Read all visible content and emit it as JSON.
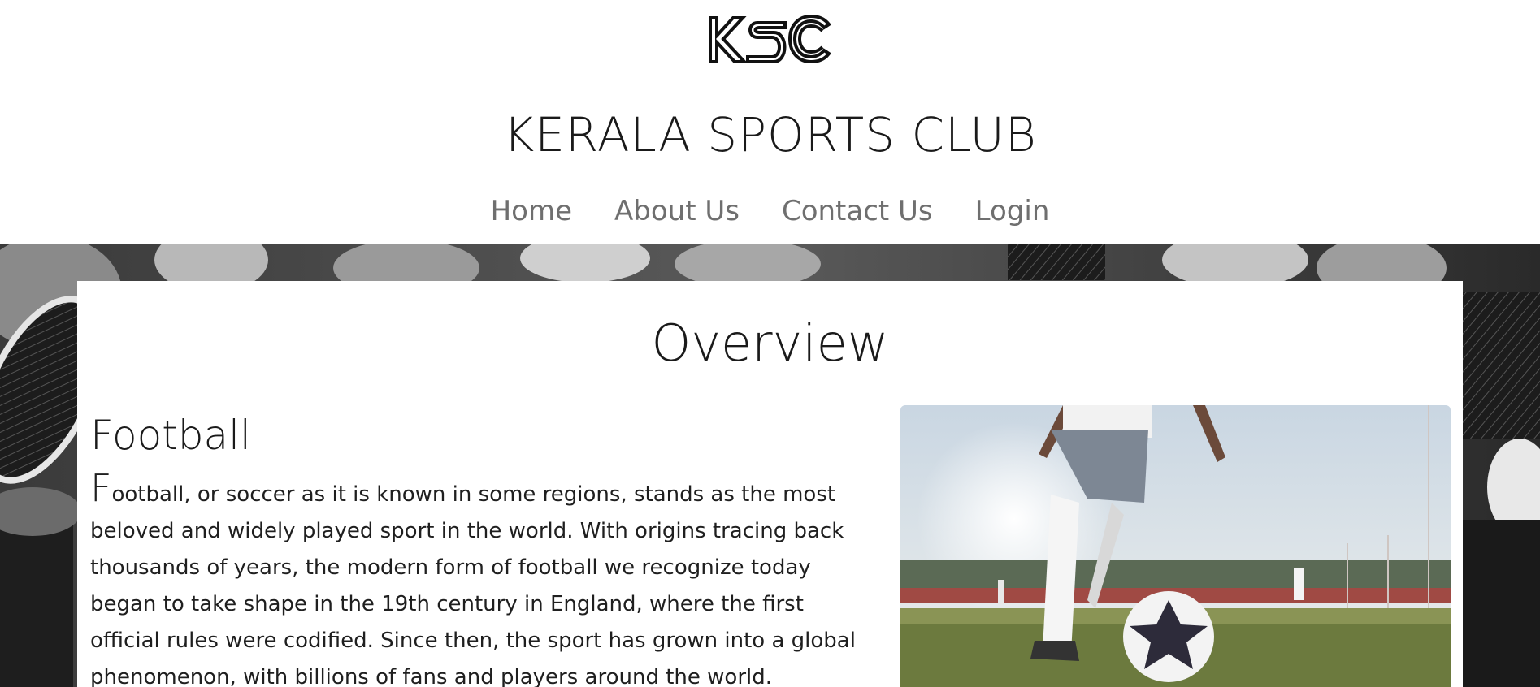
{
  "header": {
    "logo_text": "KSC",
    "site_title": "KERALA SPORTS CLUB"
  },
  "nav": {
    "items": [
      "Home",
      "About Us",
      "Contact Us",
      "Login"
    ]
  },
  "main": {
    "page_heading": "Overview",
    "section": {
      "title": "Football",
      "first_letter": "F",
      "paragraph": "ootball, or soccer as it is known in some regions, stands as the most beloved and widely played sport in the world. With origins tracing back thousands of years, the modern form of football we recognize today began to take shape in the 19th century in England, where the first official rules were codified. Since then, the sport has grown into a global phenomenon, with billions of fans and players around the world."
    }
  },
  "colors": {
    "nav_text": "#6f6f6f",
    "title_text": "#1a1a1a",
    "background": "#ffffff"
  }
}
